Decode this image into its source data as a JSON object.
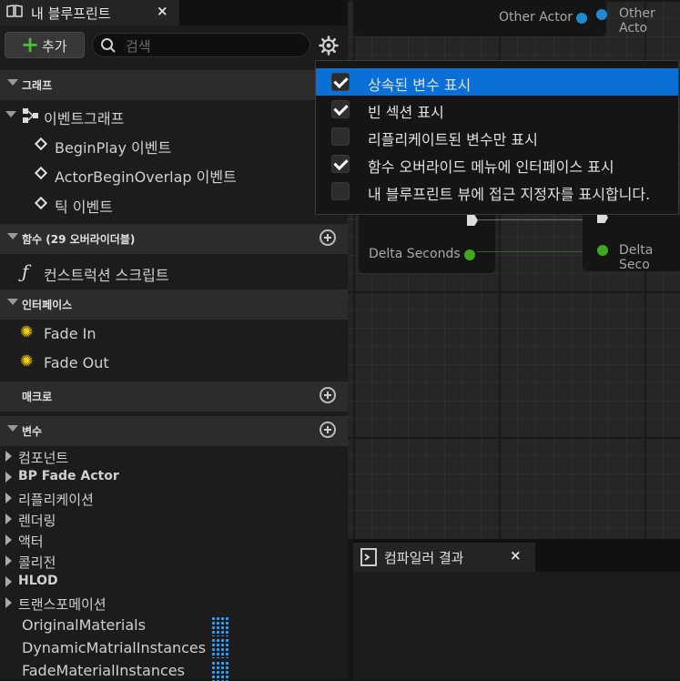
{
  "tab": {
    "title": "내 블루프린트",
    "close": "×"
  },
  "toolbar": {
    "add_label": "추가",
    "search_placeholder": "검색"
  },
  "sections": {
    "graphs": "그래프",
    "functions": "함수 (29 오버라이더블)",
    "interfaces": "인터페이스",
    "macros": "매크로",
    "variables": "변수"
  },
  "graph_items": {
    "event_graph": "이벤트그래프",
    "events": [
      "BeginPlay 이벤트",
      "ActorBeginOverlap 이벤트",
      "틱 이벤트"
    ]
  },
  "function_items": [
    "컨스트럭션 스크립트"
  ],
  "interface_items": [
    "Fade In",
    "Fade Out"
  ],
  "variable_categories": [
    "컴포넌트",
    "BP Fade Actor",
    "리플리케이션",
    "렌더링",
    "액터",
    "콜리전",
    "HLOD",
    "트랜스포메이션"
  ],
  "variables": [
    "OriginalMaterials",
    "DynamicMatrialInstances",
    "FadeMaterialInstances"
  ],
  "graph": {
    "pins": {
      "other_actor_1": "Other Actor",
      "other_actor_2": "Other Acto",
      "delta_1": "Delta Seconds",
      "delta_2": "Delta Seco"
    }
  },
  "compiler": {
    "title": "컴파일러 결과",
    "close": "×"
  },
  "menu": {
    "items": [
      {
        "label": "상속된 변수 표시",
        "checked": true,
        "highlighted": true
      },
      {
        "label": "빈 섹션 표시",
        "checked": true
      },
      {
        "label": "리플리케이트된 변수만 표시",
        "checked": false
      },
      {
        "label": "함수 오버라이드 메뉴에 인터페이스 표시",
        "checked": true
      },
      {
        "label": "내 블루프린트 뷰에 접근 지정자를 표시합니다.",
        "checked": false
      }
    ]
  },
  "colors": {
    "accent": "#0a70d8",
    "add_green": "#4fbf3a",
    "object_pin": "#1f8ad0",
    "float_pin": "#3fa81e",
    "interface_icon": "#f5d000",
    "array_icon": "#2ea0ff"
  }
}
